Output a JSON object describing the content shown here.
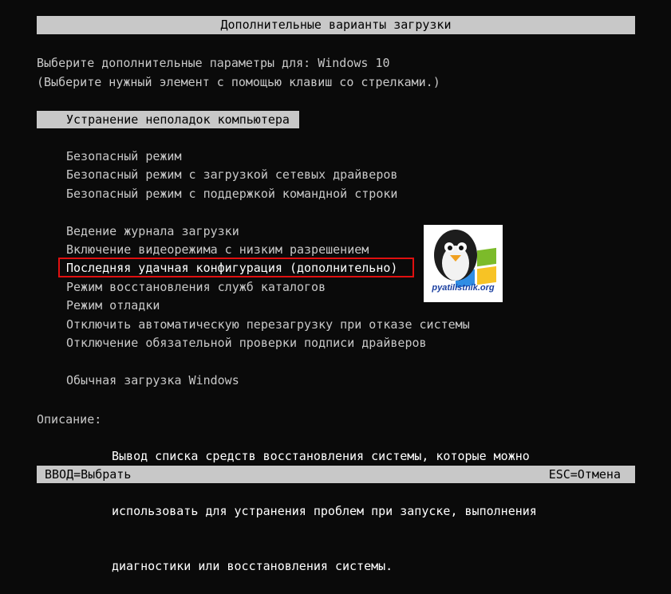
{
  "header": {
    "title": "Дополнительные варианты загрузки"
  },
  "prompt": {
    "line1": "Выберите дополнительные параметры для: Windows 10",
    "line2": "(Выберите нужный элемент с помощью клавиш со стрелками.)"
  },
  "menu": {
    "selected": "Устранение неполадок компьютера",
    "group1": [
      "Безопасный режим",
      "Безопасный режим с загрузкой сетевых драйверов",
      "Безопасный режим с поддержкой командной строки"
    ],
    "group2": [
      "Ведение журнала загрузки",
      "Включение видеорежима с низким разрешением",
      "Последняя удачная конфигурация (дополнительно)",
      "Режим восстановления служб каталогов",
      "Режим отладки",
      "Отключить автоматическую перезагрузку при отказе системы",
      "Отключение обязательной проверки подписи драйверов"
    ],
    "normal": "Обычная загрузка Windows"
  },
  "description": {
    "label": "Описание:",
    "lines": [
      "Вывод списка средств восстановления системы, которые можно",
      "использовать для устранения проблем при запуске, выполнения",
      "диагностики или восстановления системы."
    ]
  },
  "footer": {
    "left": "ВВОД=Выбрать",
    "right": "ESC=Отмена"
  },
  "watermark": {
    "text": "pyatilistnik.org"
  },
  "colors": {
    "highlight": "#e01010",
    "bar": "#c8c8c8",
    "background": "#0a0a0a"
  }
}
